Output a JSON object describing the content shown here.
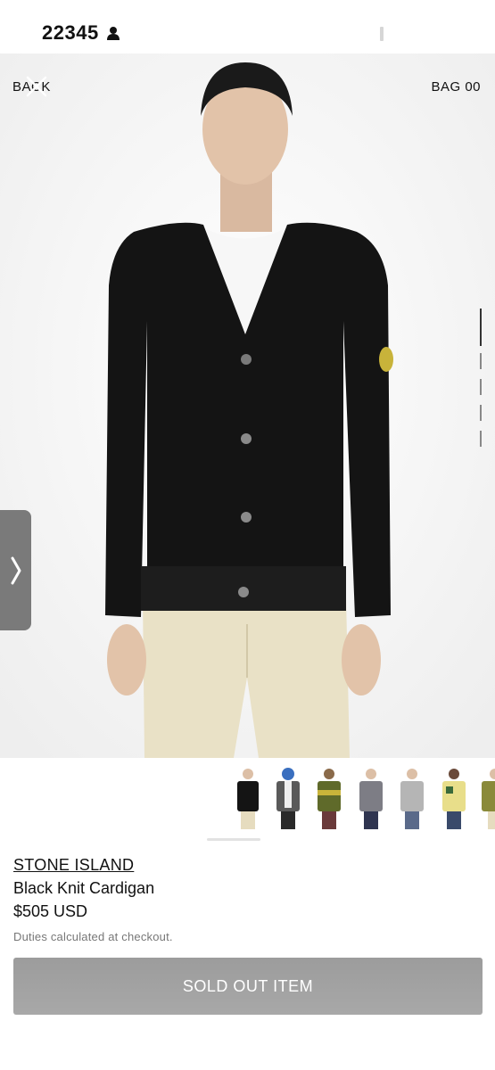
{
  "status_bar": {
    "time": "22345"
  },
  "header": {
    "back_label": "BACK",
    "bag_label": "BAG 00"
  },
  "product": {
    "brand": "STONE ISLAND",
    "name": "Black Knit Cardigan",
    "price": "$505 USD",
    "duties_note": "Duties calculated at checkout.",
    "cta_label": "SOLD OUT ITEM"
  },
  "colors": {
    "button_bg": "#a3a3a3",
    "cardigan": "#141414",
    "trousers": "#e9e1c6"
  }
}
